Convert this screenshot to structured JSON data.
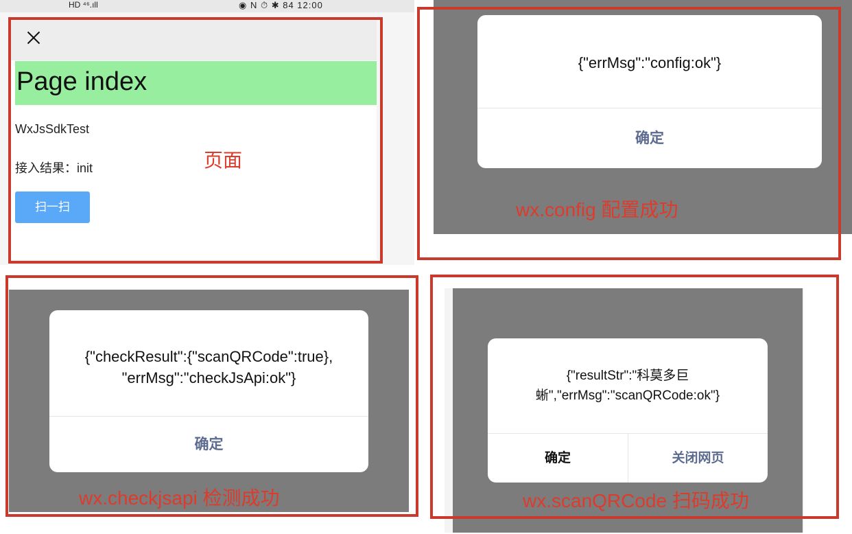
{
  "colors": {
    "annotation_red": "#c93a2d",
    "caption_red": "#dd3b2b",
    "page_head_green": "#98ee9f",
    "scan_button_blue": "#5aa9f8",
    "overlay_grey": "#7c7c7d",
    "dialog_button_blue": "#5c6b8f"
  },
  "phone": {
    "status_left": "HD ⁴⁶.ıll",
    "status_right": "◉ N ⏱ ✱ 84 12:00",
    "close_icon": "close-icon",
    "page_title": "Page index",
    "app_name": "WxJsSdkTest",
    "result_text": "接入结果：init",
    "scan_button": "扫一扫",
    "caption": "页面"
  },
  "config_panel": {
    "message": "{\"errMsg\":\"config:ok\"}",
    "ok_button": "确定",
    "caption": "wx.config 配置成功"
  },
  "checkjsapi_panel": {
    "message_line1": "{\"checkResult\":{\"scanQRCode\":true},",
    "message_line2": "\"errMsg\":\"checkJsApi:ok\"}",
    "ok_button": "确定",
    "caption": "wx.checkjsapi 检测成功"
  },
  "scan_panel": {
    "message_line1": "{\"resultStr\":\"科莫多巨",
    "message_line2": "蜥\",\"errMsg\":\"scanQRCode:ok\"}",
    "ok_button": "确定",
    "close_button": "关闭网页",
    "caption": "wx.scanQRCode 扫码成功"
  }
}
